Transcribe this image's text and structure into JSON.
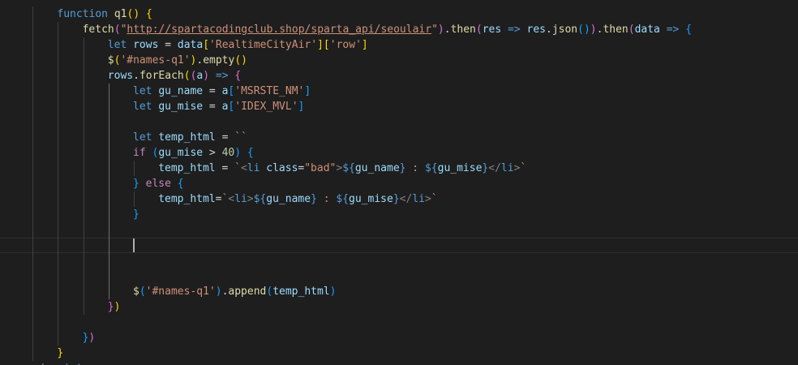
{
  "editor": {
    "language": "javascript",
    "theme_colors": {
      "background": "#1e1e1e",
      "keyword": "#569cd6",
      "control": "#c586c0",
      "function": "#dcdcaa",
      "variable": "#9cdcfe",
      "string": "#ce9178",
      "number": "#b5cea8",
      "bracket_level_1": "#ffd700",
      "bracket_level_2": "#da70d6",
      "bracket_level_3": "#179fff"
    },
    "lines": [
      {
        "indent": 2,
        "tokens": [
          [
            "kw",
            "function"
          ],
          [
            "punc",
            " "
          ],
          [
            "fn",
            "q1"
          ],
          [
            "b1",
            "()"
          ],
          [
            "punc",
            " "
          ],
          [
            "b1",
            "{"
          ]
        ]
      },
      {
        "indent": 3,
        "tokens": [
          [
            "fn",
            "fetch"
          ],
          [
            "b2",
            "("
          ],
          [
            "str",
            "\""
          ],
          [
            "str url",
            "http://spartacodingclub.shop/sparta_api/seoulair"
          ],
          [
            "str",
            "\""
          ],
          [
            "b2",
            ")"
          ],
          [
            "punc",
            "."
          ],
          [
            "fn",
            "then"
          ],
          [
            "b2",
            "("
          ],
          [
            "var",
            "res"
          ],
          [
            "punc",
            " "
          ],
          [
            "kw",
            "=>"
          ],
          [
            "punc",
            " "
          ],
          [
            "var",
            "res"
          ],
          [
            "punc",
            "."
          ],
          [
            "fn",
            "json"
          ],
          [
            "b3",
            "()"
          ],
          [
            "b2",
            ")"
          ],
          [
            "punc",
            "."
          ],
          [
            "fn",
            "then"
          ],
          [
            "b2",
            "("
          ],
          [
            "var",
            "data"
          ],
          [
            "punc",
            " "
          ],
          [
            "kw",
            "=>"
          ],
          [
            "punc",
            " "
          ],
          [
            "b3",
            "{"
          ]
        ]
      },
      {
        "indent": 4,
        "tokens": [
          [
            "kw",
            "let"
          ],
          [
            "punc",
            " "
          ],
          [
            "var",
            "rows"
          ],
          [
            "punc",
            " = "
          ],
          [
            "var",
            "data"
          ],
          [
            "b1",
            "["
          ],
          [
            "str",
            "'RealtimeCityAir'"
          ],
          [
            "b1",
            "]["
          ],
          [
            "str",
            "'row'"
          ],
          [
            "b1",
            "]"
          ]
        ]
      },
      {
        "indent": 4,
        "tokens": [
          [
            "fn",
            "$"
          ],
          [
            "b1",
            "("
          ],
          [
            "str",
            "'#names-q1'"
          ],
          [
            "b1",
            ")"
          ],
          [
            "punc",
            "."
          ],
          [
            "fn",
            "empty"
          ],
          [
            "b1",
            "()"
          ]
        ]
      },
      {
        "indent": 4,
        "tokens": [
          [
            "var",
            "rows"
          ],
          [
            "punc",
            "."
          ],
          [
            "fn",
            "forEach"
          ],
          [
            "b1",
            "("
          ],
          [
            "b2",
            "("
          ],
          [
            "var",
            "a"
          ],
          [
            "b2",
            ")"
          ],
          [
            "punc",
            " "
          ],
          [
            "kw",
            "=>"
          ],
          [
            "punc",
            " "
          ],
          [
            "b2",
            "{"
          ]
        ]
      },
      {
        "indent": 5,
        "tokens": [
          [
            "kw",
            "let"
          ],
          [
            "punc",
            " "
          ],
          [
            "var",
            "gu_name"
          ],
          [
            "punc",
            " = "
          ],
          [
            "var",
            "a"
          ],
          [
            "b3",
            "["
          ],
          [
            "str",
            "'MSRSTE_NM'"
          ],
          [
            "b3",
            "]"
          ]
        ]
      },
      {
        "indent": 5,
        "tokens": [
          [
            "kw",
            "let"
          ],
          [
            "punc",
            " "
          ],
          [
            "var",
            "gu_mise"
          ],
          [
            "punc",
            " = "
          ],
          [
            "var",
            "a"
          ],
          [
            "b3",
            "["
          ],
          [
            "str",
            "'IDEX_MVL'"
          ],
          [
            "b3",
            "]"
          ]
        ]
      },
      {
        "indent": 5,
        "tokens": []
      },
      {
        "indent": 5,
        "tokens": [
          [
            "kw",
            "let"
          ],
          [
            "punc",
            " "
          ],
          [
            "var",
            "temp_html"
          ],
          [
            "punc",
            " = "
          ],
          [
            "str",
            "``"
          ]
        ]
      },
      {
        "indent": 5,
        "tokens": [
          [
            "ctl",
            "if"
          ],
          [
            "punc",
            " "
          ],
          [
            "b3",
            "("
          ],
          [
            "var",
            "gu_mise"
          ],
          [
            "punc",
            " > "
          ],
          [
            "num",
            "40"
          ],
          [
            "b3",
            ")"
          ],
          [
            "punc",
            " "
          ],
          [
            "b3",
            "{"
          ]
        ]
      },
      {
        "indent": 6,
        "tokens": [
          [
            "var",
            "temp_html"
          ],
          [
            "punc",
            " = "
          ],
          [
            "str",
            "`"
          ],
          [
            "tagp",
            "<"
          ],
          [
            "tag",
            "li"
          ],
          [
            "punc",
            " "
          ],
          [
            "var",
            "class"
          ],
          [
            "punc",
            "="
          ],
          [
            "str",
            "\"bad\""
          ],
          [
            "tagp",
            ">"
          ],
          [
            "tpl",
            "${"
          ],
          [
            "var",
            "gu_name"
          ],
          [
            "tpl",
            "}"
          ],
          [
            "str",
            " : "
          ],
          [
            "tpl",
            "${"
          ],
          [
            "var",
            "gu_mise"
          ],
          [
            "tpl",
            "}"
          ],
          [
            "tagp",
            "</"
          ],
          [
            "tag",
            "li"
          ],
          [
            "tagp",
            ">"
          ],
          [
            "str",
            "`"
          ]
        ]
      },
      {
        "indent": 5,
        "tokens": [
          [
            "b3",
            "}"
          ],
          [
            "punc",
            " "
          ],
          [
            "ctl",
            "else"
          ],
          [
            "punc",
            " "
          ],
          [
            "b3",
            "{"
          ]
        ]
      },
      {
        "indent": 6,
        "tokens": [
          [
            "var",
            "temp_html"
          ],
          [
            "punc",
            "="
          ],
          [
            "str",
            "`"
          ],
          [
            "tagp",
            "<"
          ],
          [
            "tag",
            "li"
          ],
          [
            "tagp",
            ">"
          ],
          [
            "tpl",
            "${"
          ],
          [
            "var",
            "gu_name"
          ],
          [
            "tpl",
            "}"
          ],
          [
            "str",
            " : "
          ],
          [
            "tpl",
            "${"
          ],
          [
            "var",
            "gu_mise"
          ],
          [
            "tpl",
            "}"
          ],
          [
            "tagp",
            "</"
          ],
          [
            "tag",
            "li"
          ],
          [
            "tagp",
            ">"
          ],
          [
            "str",
            "`"
          ]
        ]
      },
      {
        "indent": 5,
        "tokens": [
          [
            "b3",
            "}"
          ]
        ]
      },
      {
        "indent": 5,
        "tokens": []
      },
      {
        "indent": 5,
        "tokens": [],
        "current": true
      },
      {
        "indent": 5,
        "tokens": []
      },
      {
        "indent": 5,
        "tokens": []
      },
      {
        "indent": 5,
        "tokens": [
          [
            "fn",
            "$"
          ],
          [
            "b3",
            "("
          ],
          [
            "str",
            "'#names-q1'"
          ],
          [
            "b3",
            ")"
          ],
          [
            "punc",
            "."
          ],
          [
            "fn",
            "append"
          ],
          [
            "b3",
            "("
          ],
          [
            "var",
            "temp_html"
          ],
          [
            "b3",
            ")"
          ]
        ]
      },
      {
        "indent": 4,
        "tokens": [
          [
            "b2",
            "}"
          ],
          [
            "b1",
            ")"
          ]
        ]
      },
      {
        "indent": 3,
        "tokens": []
      },
      {
        "indent": 3,
        "tokens": [
          [
            "b3",
            "}"
          ],
          [
            "b2",
            ")"
          ]
        ]
      },
      {
        "indent": 2,
        "tokens": [
          [
            "b1",
            "}"
          ]
        ]
      },
      {
        "indent": 1,
        "tokens": [
          [
            "tagp",
            "</"
          ],
          [
            "tag",
            "script"
          ],
          [
            "tagp",
            ">"
          ]
        ]
      }
    ]
  }
}
